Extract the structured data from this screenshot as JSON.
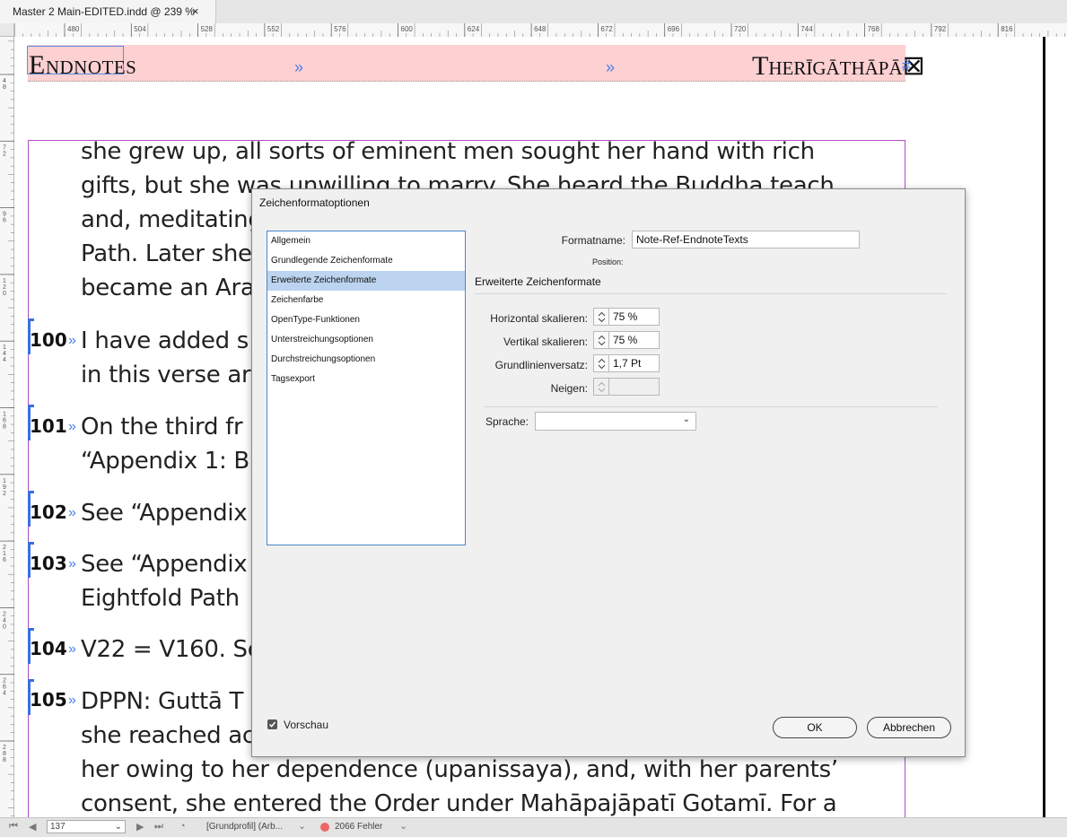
{
  "window": {
    "tab_title": "Master 2 Main-EDITED.indd @ 239 %",
    "tab_close": "×"
  },
  "ruler": {
    "h_labels": [
      "480",
      "504",
      "528",
      "552",
      "576",
      "600",
      "624",
      "648",
      "672",
      "696",
      "720",
      "744",
      "768",
      "792",
      "816"
    ],
    "v_labels": [
      "4\n8",
      "7\n2",
      "9\n6",
      "1\n2\n0",
      "1\n4\n4",
      "1\n6\n8",
      "1\n9\n2",
      "2\n1\n6",
      "2\n4\n0",
      "2\n6\n4",
      "2\n8\n8"
    ]
  },
  "document": {
    "header_left": "Endnotes",
    "header_right": "Therīgāthāpā⊠",
    "header_tab_marks": [
      "»",
      "»"
    ],
    "header_hash": "#",
    "body_lines": [
      "she grew up, all sorts of eminent men sought her hand with rich",
      "gifts, but she was unwilling to marry.  She heard the Buddha teach",
      "and, meditating",
      "Path.  Later she",
      "became an Ara",
      "I have added s",
      "in this verse ar",
      "On the third fr",
      "“Appendix 1: B",
      "See “Appendix",
      "See “Appendix",
      "Eightfold Path",
      "V22 = V160.  Se",
      "DPPN: Guttā T",
      "she reached ac",
      "her owing to her dependence (upanissaya), and, with her parents’",
      "consent, she entered the Order under Mahāpajāpatī Gotamī.  For a"
    ],
    "notes": [
      {
        "num": "100",
        "arrow": "»"
      },
      {
        "num": "101",
        "arrow": "»"
      },
      {
        "num": "102",
        "arrow": "»"
      },
      {
        "num": "103",
        "arrow": "»"
      },
      {
        "num": "104",
        "arrow": "»"
      },
      {
        "num": "105",
        "arrow": "»"
      }
    ]
  },
  "dialog": {
    "title": "Zeichenformatoptionen",
    "categories": [
      "Allgemein",
      "Grundlegende Zeichenformate",
      "Erweiterte Zeichenformate",
      "Zeichenfarbe",
      "OpenType-Funktionen",
      "Unterstreichungsoptionen",
      "Durchstreichungsoptionen",
      "Tagsexport"
    ],
    "selected_category_index": 2,
    "formatname_label": "Formatname:",
    "formatname_value": "Note-Ref-EndnoteTexts",
    "position_label": "Position:",
    "section_title": "Erweiterte Zeichenformate",
    "fields": [
      {
        "label": "Horizontal skalieren:",
        "value": "75 %"
      },
      {
        "label": "Vertikal skalieren:",
        "value": "75 %"
      },
      {
        "label": "Grundlinienversatz:",
        "value": "1,7 Pt"
      },
      {
        "label": "Neigen:",
        "value": ""
      }
    ],
    "language_label": "Sprache:",
    "language_value": "",
    "preview_label": "Vorschau",
    "preview_checked": true,
    "ok_label": "OK",
    "cancel_label": "Abbrechen"
  },
  "statusbar": {
    "page_value": "137",
    "profile": "[Grundprofil] (Arb...",
    "errors": "2066 Fehler",
    "error_color": "#e66666"
  },
  "colors": {
    "header_band": "#fdd0d2",
    "frame_border": "#b04dc4",
    "accent": "#3b6fe0"
  }
}
